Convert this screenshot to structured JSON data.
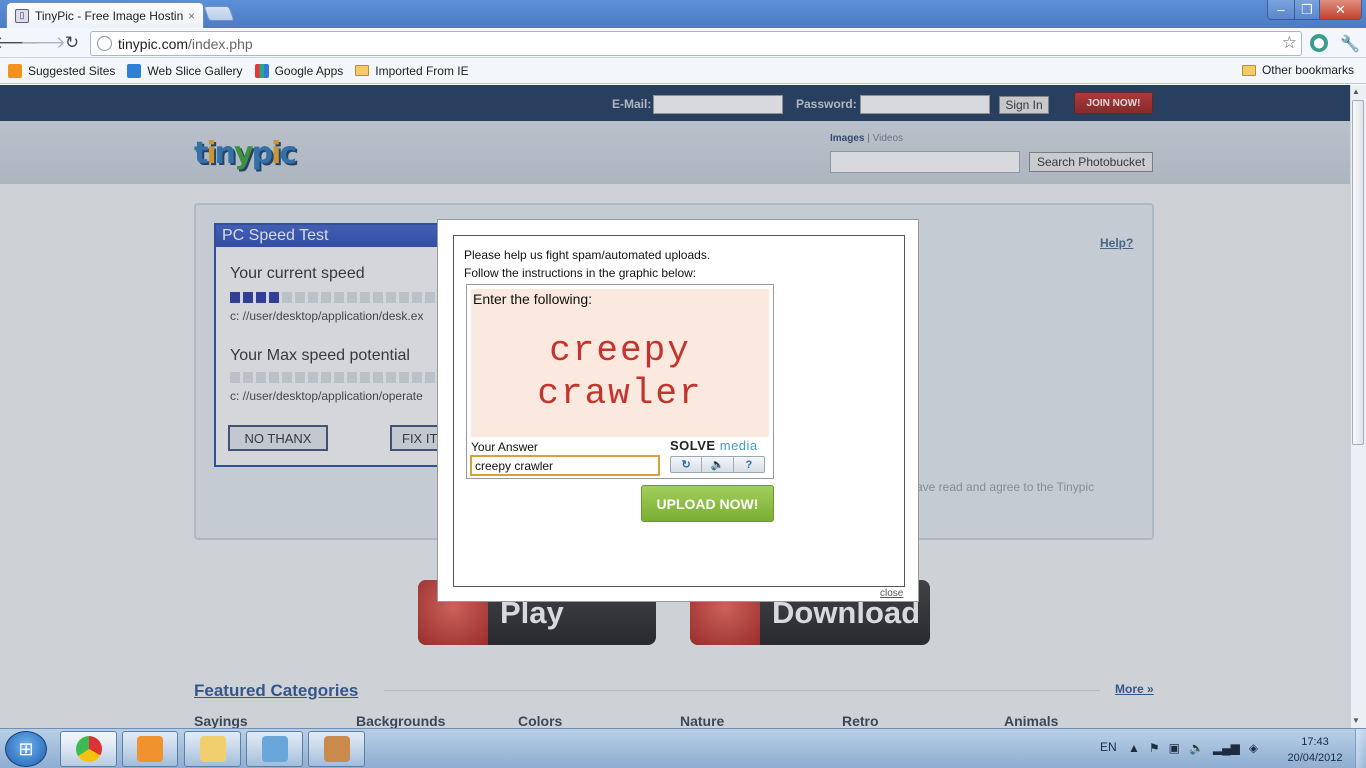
{
  "browser": {
    "tab_title": "TinyPic - Free Image Hostin",
    "tab_close": "×",
    "url_domain": "tinypic.com",
    "url_path": "/index.php",
    "window_controls": {
      "minimize": "‒",
      "maximize": "❐",
      "close": "✕"
    }
  },
  "bookmarks": {
    "items": [
      "Suggested Sites",
      "Web Slice Gallery",
      "Google Apps",
      "Imported From IE"
    ],
    "other": "Other bookmarks"
  },
  "topbar": {
    "email_label": "E-Mail:",
    "password_label": "Password:",
    "signin_label": "Sign In",
    "join_label": "JOIN NOW!"
  },
  "header": {
    "search_tab_images": "Images",
    "search_tab_sep": " | ",
    "search_tab_videos": "Videos",
    "search_button": "Search Photobucket"
  },
  "main": {
    "help_link": "Help?",
    "agree_text": "ave read and agree to the Tinypic"
  },
  "ad": {
    "title": "PC Speed Test",
    "current_speed_label": "Your current speed",
    "current_speed_bars": 4,
    "total_bars": 17,
    "path1": "c: //user/desktop/application/desk.ex",
    "max_speed_label": "Your Max speed potential",
    "max_speed_bars": 0,
    "path2": "c: //user/desktop/application/operate",
    "btn_no": "NO THANX",
    "btn_fix": "FIX IT"
  },
  "promo": {
    "play": "Play",
    "download": "Download"
  },
  "featured": {
    "title": "Featured Categories",
    "more": "More »",
    "categories": [
      "Sayings",
      "Backgrounds",
      "Colors",
      "Nature",
      "Retro",
      "Animals"
    ]
  },
  "modal": {
    "line1": "Please help us fight spam/automated uploads.",
    "line2": "Follow the instructions in the graphic below:",
    "captcha_instruction": "Enter the following:",
    "captcha_word1": "creepy",
    "captcha_word2": "crawler",
    "answer_label": "Your Answer",
    "answer_value": "creepy crawler",
    "brand_solve": "SOLVE",
    "brand_media": "media",
    "control_refresh": "↻",
    "control_audio": "🔈",
    "control_help": "?",
    "upload_button": "UPLOAD NOW!",
    "close_link": "close"
  },
  "taskbar": {
    "language": "EN",
    "time": "17:43",
    "date": "20/04/2012"
  }
}
